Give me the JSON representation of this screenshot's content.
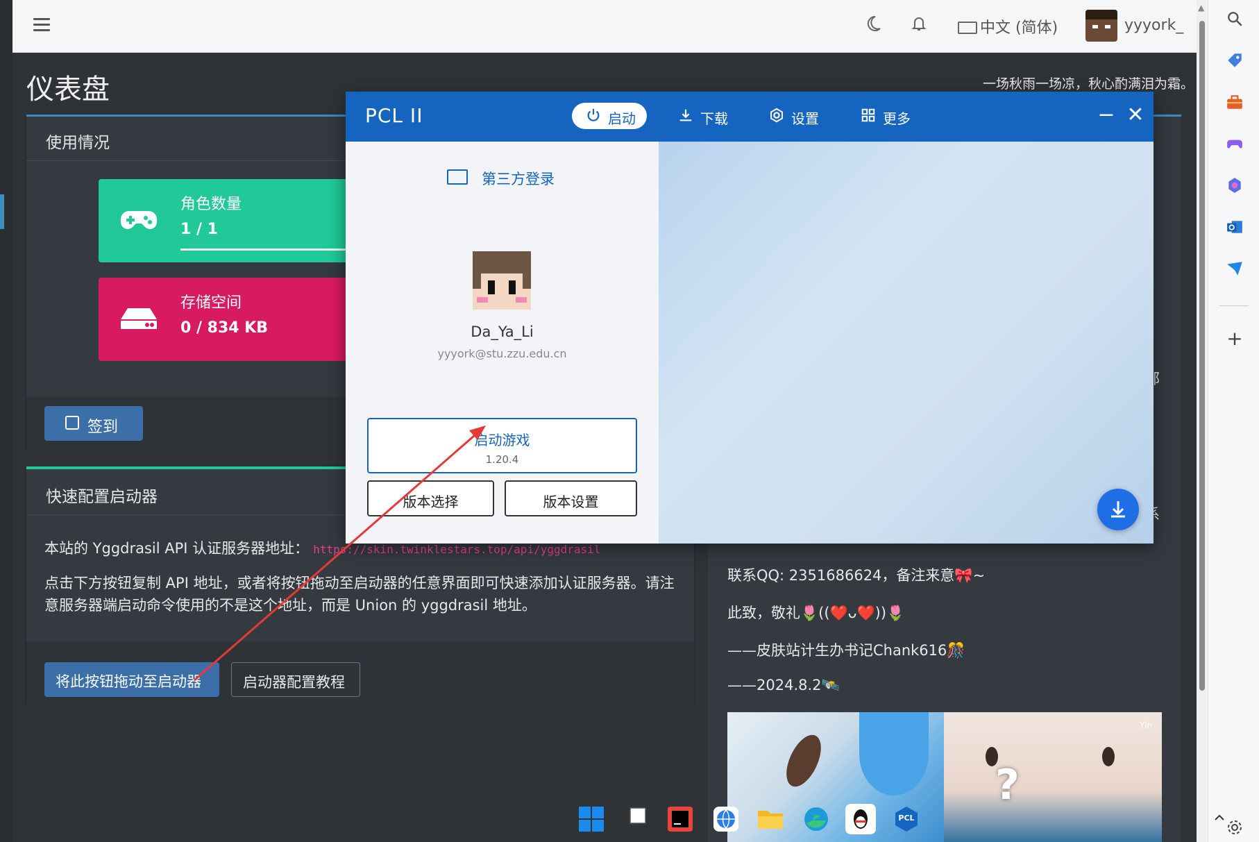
{
  "topnav": {
    "language": "中文 (简体)",
    "username": "yyyork_"
  },
  "page": {
    "title": "仪表盘",
    "motto": "一场秋雨一场凉，秋心酌满泪为霜。"
  },
  "usage": {
    "title": "使用情况",
    "roles_label": "角色数量",
    "roles_value": "1 / 1",
    "roles_fraction": 1,
    "storage_label": "存储空间",
    "storage_value": "0 / 834 KB",
    "storage_fraction": 0,
    "checkin_label": "签到"
  },
  "launcher": {
    "title": "快速配置启动器",
    "api_prefix": "本站的 Yggdrasil API 认证服务器地址：",
    "api_url": "https://skin.twinklestars.top/api/yggdrasil",
    "description": "点击下方按钮复制 API 地址，或者将按钮拖动至启动器的任意界面即可快速添加认证服务器。请注意服务器端启动命令使用的不是这个地址，而是 Union 的 yggdrasil 地址。",
    "drag_button": "将此按钮拖动至启动器",
    "tutorial_button": "启动器配置教程"
  },
  "right_card": {
    "peek_1": "部",
    "peek_2": "系",
    "line_qq": "联系QQ: 2351686624，备注来意🎀~",
    "line_regards": "此致，敬礼🌷((❤️ᴗ❤️))🌷",
    "line_sign": "——皮肤站计生办书记Chank616🎊",
    "line_date": "——2024.8.2🛰️",
    "photo_watermark": "Yin"
  },
  "pcl": {
    "logo": "PCL II",
    "nav": [
      "启动",
      "下载",
      "设置",
      "更多"
    ],
    "third_party_login": "第三方登录",
    "player_name": "Da_Ya_Li",
    "player_email": "yyyork@stu.zzu.edu.cn",
    "launch_label": "启动游戏",
    "launch_version": "1.20.4",
    "version_select": "版本选择",
    "version_settings": "版本设置",
    "accent_color": "#1565c0"
  },
  "taskbar": {
    "pcl_label": "PCL"
  }
}
